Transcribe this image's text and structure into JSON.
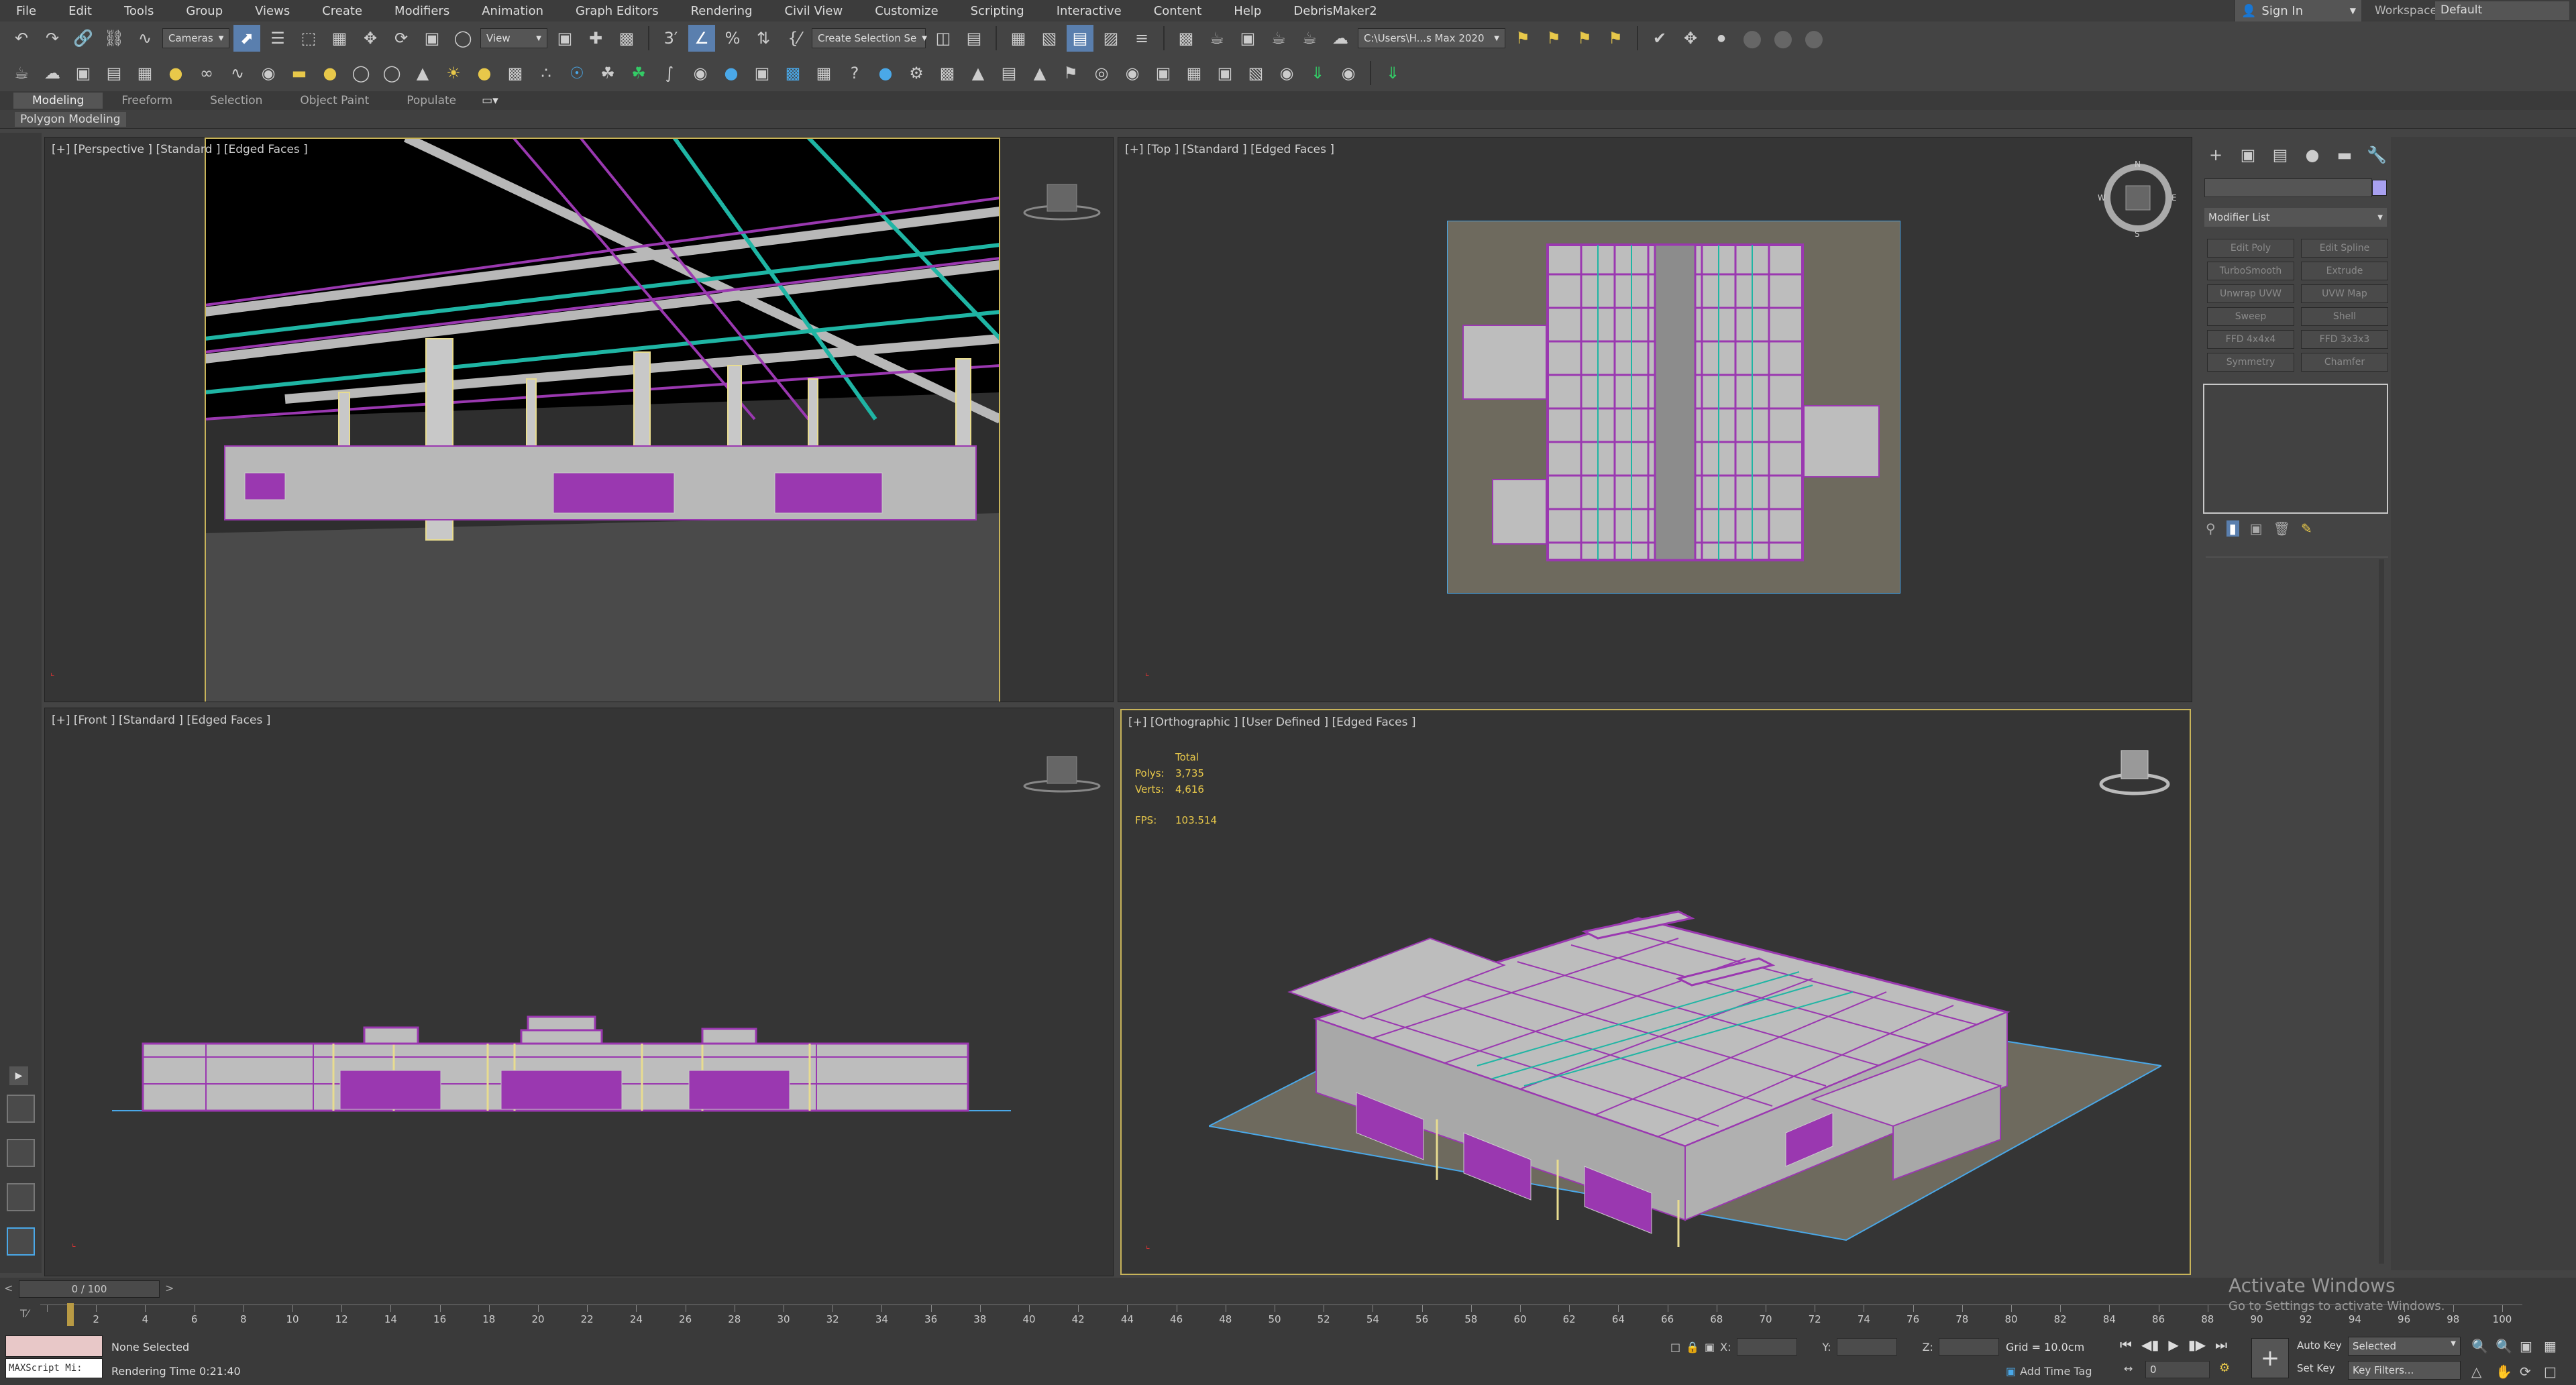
{
  "menu": [
    "File",
    "Edit",
    "Tools",
    "Group",
    "Views",
    "Create",
    "Modifiers",
    "Animation",
    "Graph Editors",
    "Rendering",
    "Civil View",
    "Customize",
    "Scripting",
    "Interactive",
    "Content",
    "Help",
    "DebrisMaker2"
  ],
  "account": {
    "sign_in": "Sign In",
    "workspaces_label": "Workspaces:",
    "workspace": "Default"
  },
  "toolbar": {
    "cameras": "Cameras",
    "view": "View",
    "selection_set": "Create Selection Se",
    "project_path": "C:\\Users\\H...s Max 2020"
  },
  "ribbon": {
    "tabs": [
      "Modeling",
      "Freeform",
      "Selection",
      "Object Paint",
      "Populate"
    ],
    "active": "Modeling",
    "sub": "Polygon Modeling"
  },
  "viewports": {
    "perspective": {
      "label": "[+] [Perspective ] [Standard ] [Edged Faces ]"
    },
    "top": {
      "label": "[+] [Top ] [Standard ] [Edged Faces ]"
    },
    "front": {
      "label": "[+] [Front ] [Standard ] [Edged Faces ]"
    },
    "ortho": {
      "label": "[+] [Orthographic ] [User Defined ] [Edged Faces ]",
      "stats": {
        "header": "Total",
        "polys_label": "Polys:",
        "polys": "3,735",
        "verts_label": "Verts:",
        "verts": "4,616",
        "fps_label": "FPS:",
        "fps": "103.514"
      }
    }
  },
  "command_panel": {
    "modifier_list": "Modifier List",
    "modifiers": [
      "Edit Poly",
      "Edit Spline",
      "TurboSmooth",
      "Extrude",
      "Unwrap UVW",
      "UVW Map",
      "Sweep",
      "Shell",
      "FFD 4x4x4",
      "FFD 3x3x3",
      "Symmetry",
      "Chamfer"
    ],
    "name_color": "#a8a0f0"
  },
  "timeline": {
    "slider": "0 / 100",
    "ticks": [
      "0",
      "2",
      "4",
      "6",
      "8",
      "10",
      "12",
      "14",
      "16",
      "18",
      "20",
      "22",
      "24",
      "26",
      "28",
      "30",
      "32",
      "34",
      "36",
      "38",
      "40",
      "42",
      "44",
      "46",
      "48",
      "50",
      "52",
      "54",
      "56",
      "58",
      "60",
      "62",
      "64",
      "66",
      "68",
      "70",
      "72",
      "74",
      "76",
      "78",
      "80",
      "82",
      "84",
      "86",
      "88",
      "90",
      "92",
      "94",
      "96",
      "98",
      "100"
    ]
  },
  "status": {
    "maxscript": "MAXScript Mi:",
    "selection": "None Selected",
    "rendering_time": "Rendering Time  0:21:40",
    "x_label": "X:",
    "y_label": "Y:",
    "z_label": "Z:",
    "grid": "Grid = 10.0cm",
    "add_time_tag": "Add Time Tag",
    "frame": "0",
    "auto_key": "Auto Key",
    "set_key": "Set Key",
    "selected": "Selected",
    "key_filters": "Key Filters..."
  },
  "watermark": {
    "title": "Activate Windows",
    "subtitle": "Go to Settings to activate Windows."
  },
  "colors": {
    "accent": "#5a7fae",
    "selection_highlight": "#c8b45a",
    "poly_purple": "#9a38b0",
    "wire_teal": "#1fb5a4"
  }
}
